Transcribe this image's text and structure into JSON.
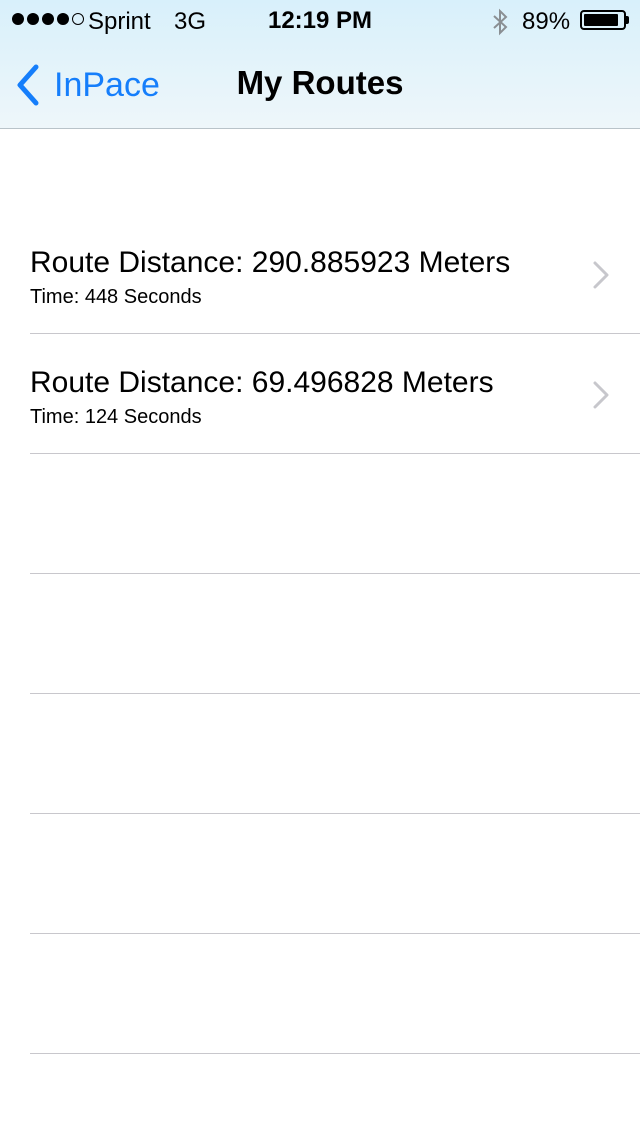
{
  "status_bar": {
    "carrier": "Sprint",
    "network": "3G",
    "time": "12:19 PM",
    "battery_percent": "89%",
    "battery_level": 0.89,
    "signal_bars": [
      true,
      true,
      true,
      true,
      false
    ]
  },
  "nav": {
    "back_label": "InPace",
    "title": "My Routes",
    "accent_color": "#157efb"
  },
  "routes": [
    {
      "distance_label": "Route Distance: 290.885923 Meters",
      "time_label": "Time: 448 Seconds"
    },
    {
      "distance_label": "Route Distance: 69.496828 Meters",
      "time_label": "Time: 124 Seconds"
    }
  ],
  "icons": [
    "bluetooth-icon",
    "battery-icon",
    "back-chevron-icon",
    "disclosure-chevron-icon"
  ]
}
